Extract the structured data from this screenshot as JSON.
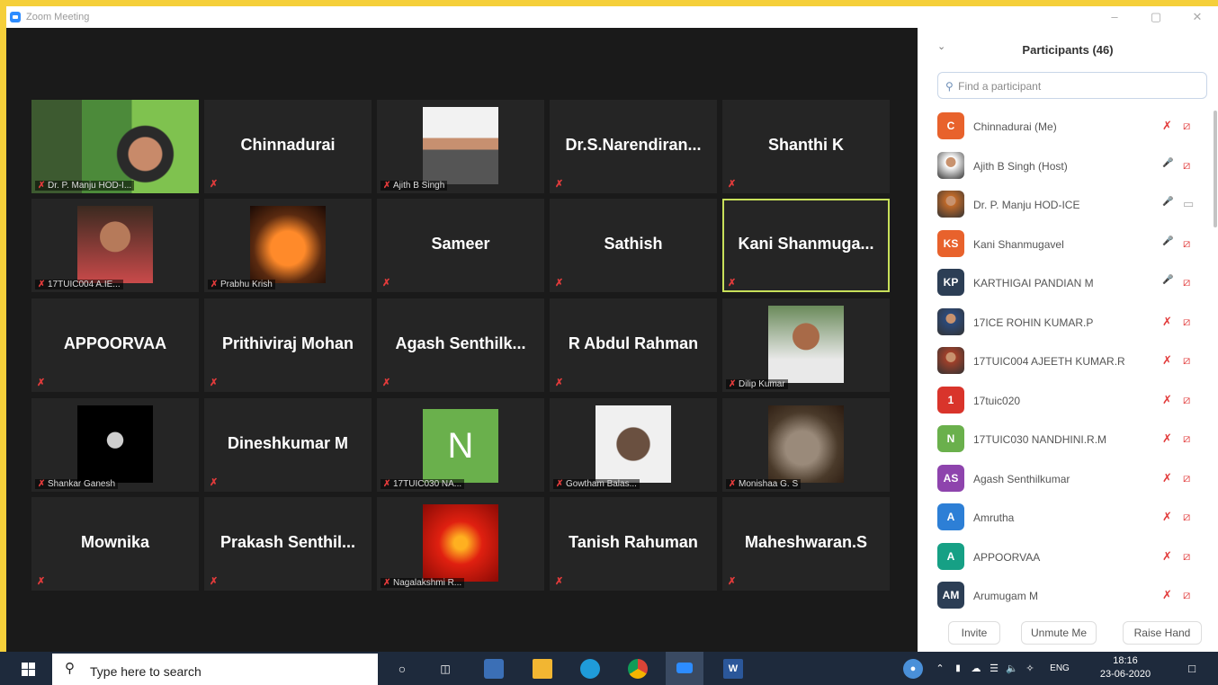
{
  "window": {
    "title": "Zoom Meeting",
    "minimize": "–",
    "maximize": "▢",
    "close": "✕"
  },
  "accent": "#c8e05a",
  "tiles": [
    {
      "name": "Dr. P. Manju HOD-I...",
      "type": "video"
    },
    {
      "name": "Chinnadurai",
      "type": "text"
    },
    {
      "name": "Ajith B Singh",
      "type": "photo"
    },
    {
      "name": "Dr.S.Narendiran...",
      "type": "text"
    },
    {
      "name": "Shanthi K",
      "type": "text"
    },
    {
      "name": "17TUIC004 A.IE...",
      "type": "photo"
    },
    {
      "name": "Prabhu Krish",
      "type": "photo"
    },
    {
      "name": "Sameer",
      "type": "text"
    },
    {
      "name": "Sathish",
      "type": "text"
    },
    {
      "name": "Kani  Shanmuga...",
      "type": "text",
      "active": true
    },
    {
      "name": "APPOORVAA",
      "type": "text"
    },
    {
      "name": "Prithiviraj Mohan",
      "type": "text"
    },
    {
      "name": "Agash  Senthilk...",
      "type": "text"
    },
    {
      "name": "R Abdul Rahman",
      "type": "text"
    },
    {
      "name": "Dilip Kumar",
      "type": "photo"
    },
    {
      "name": "Shankar Ganesh",
      "type": "photo"
    },
    {
      "name": "Dineshkumar M",
      "type": "text"
    },
    {
      "name": "17TUIC030 NA...",
      "type": "letter",
      "letter": "N"
    },
    {
      "name": "Gowtham Balas...",
      "type": "photo"
    },
    {
      "name": "Monishaa G. S",
      "type": "photo"
    },
    {
      "name": "Mownika",
      "type": "text"
    },
    {
      "name": "Prakash  Senthil...",
      "type": "text"
    },
    {
      "name": "Nagalakshmi R...",
      "type": "photo"
    },
    {
      "name": "Tanish Rahuman",
      "type": "text"
    },
    {
      "name": "Maheshwaran.S",
      "type": "text"
    }
  ],
  "panel": {
    "title": "Participants (46)",
    "search_placeholder": "Find a participant",
    "participants": [
      {
        "name": "Chinnadurai (Me)",
        "initials": "C",
        "color": "#e8622c",
        "mic": "off",
        "cam": "off"
      },
      {
        "name": "Ajith B Singh (Host)",
        "initials": "",
        "color": "#ffffff",
        "mic": "on",
        "cam": "off"
      },
      {
        "name": "Dr. P. Manju HOD-ICE",
        "initials": "",
        "color": "#c06a2a",
        "mic": "on",
        "cam": "on"
      },
      {
        "name": "Kani Shanmugavel",
        "initials": "KS",
        "color": "#e8622c",
        "mic": "on",
        "cam": "off"
      },
      {
        "name": "KARTHIGAI PANDIAN M",
        "initials": "KP",
        "color": "#2c3e55",
        "mic": "on",
        "cam": "off"
      },
      {
        "name": "17ICE ROHIN KUMAR.P",
        "initials": "",
        "color": "#2c4a7a",
        "mic": "off",
        "cam": "off"
      },
      {
        "name": "17TUIC004 AJEETH KUMAR.R",
        "initials": "",
        "color": "#a0402a",
        "mic": "off",
        "cam": "off"
      },
      {
        "name": "17tuic020",
        "initials": "1",
        "color": "#d9342b",
        "mic": "off",
        "cam": "off"
      },
      {
        "name": "17TUIC030 NANDHINI.R.M",
        "initials": "N",
        "color": "#6ab04c",
        "mic": "off",
        "cam": "off"
      },
      {
        "name": "Agash Senthilkumar",
        "initials": "AS",
        "color": "#8e44ad",
        "mic": "off",
        "cam": "off"
      },
      {
        "name": "Amrutha",
        "initials": "A",
        "color": "#2d7fd6",
        "mic": "off",
        "cam": "off"
      },
      {
        "name": "APPOORVAA",
        "initials": "A",
        "color": "#16a085",
        "mic": "off",
        "cam": "off"
      },
      {
        "name": "Arumugam M",
        "initials": "AM",
        "color": "#2c3e55",
        "mic": "off",
        "cam": "off"
      }
    ],
    "buttons": {
      "invite": "Invite",
      "unmute": "Unmute Me",
      "raise": "Raise Hand"
    }
  },
  "taskbar": {
    "search_placeholder": "Type here to search",
    "tray_lang": "ENG",
    "time": "18:16",
    "date": "23-06-2020"
  }
}
